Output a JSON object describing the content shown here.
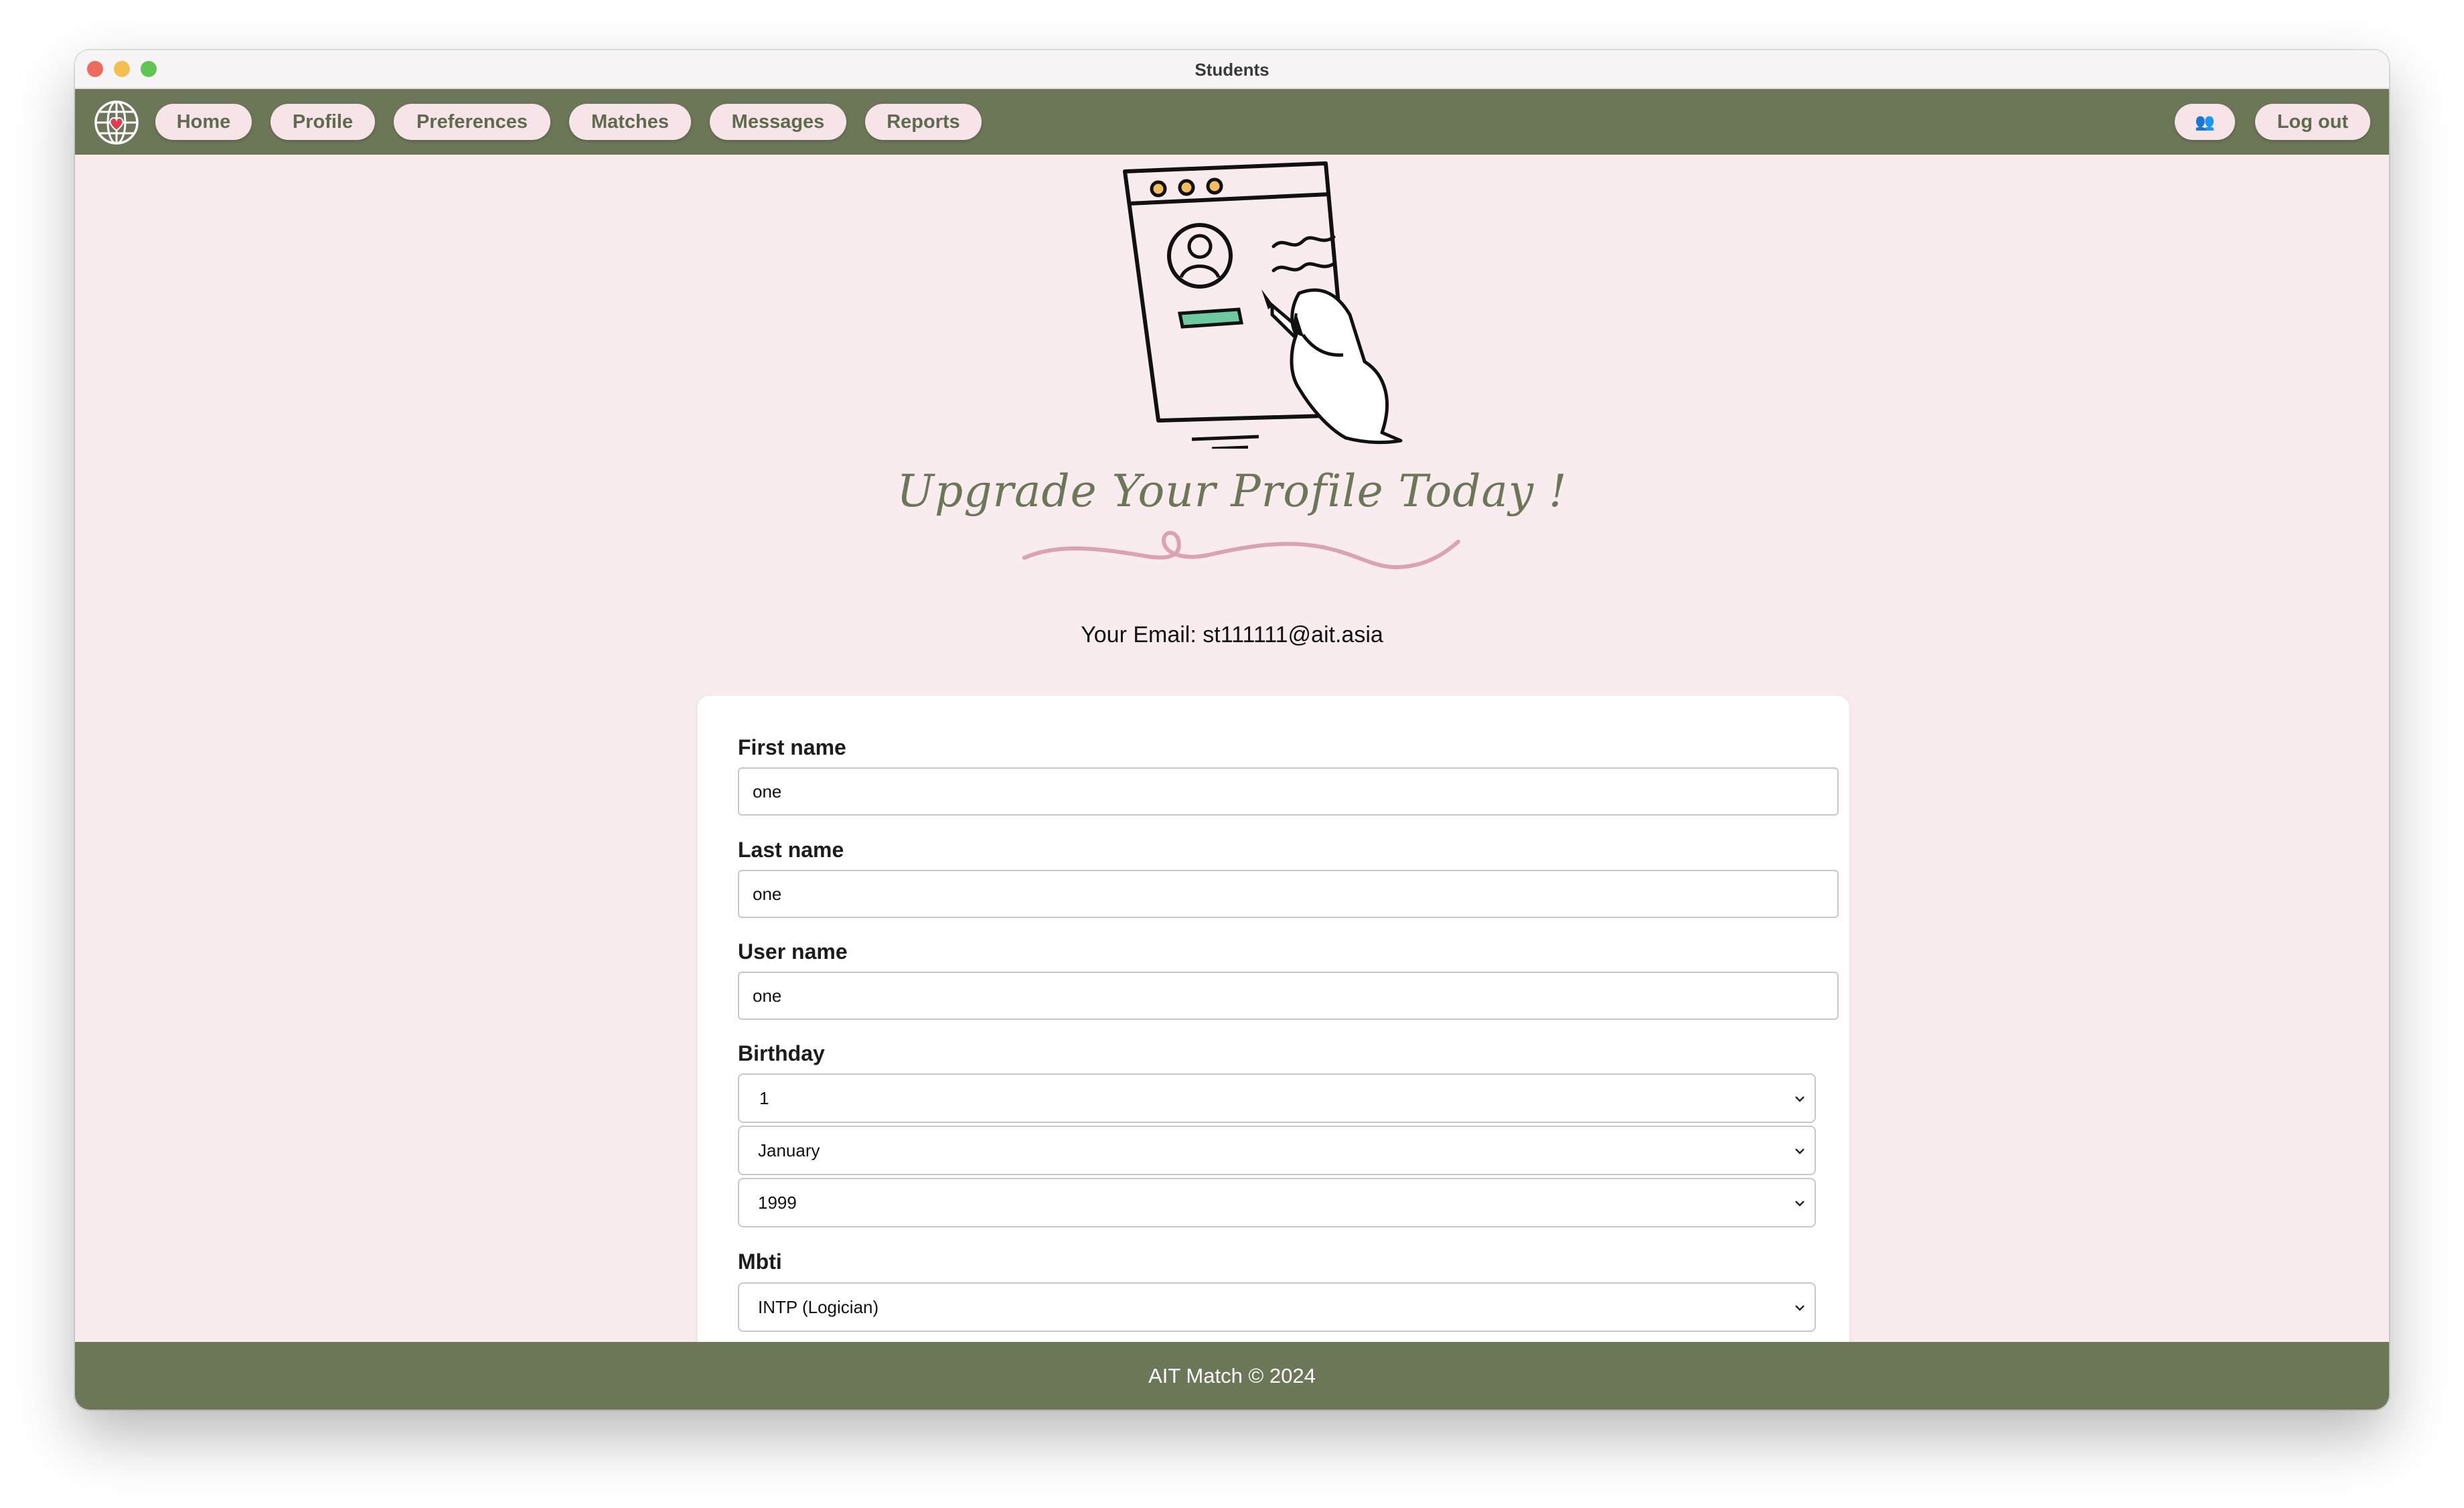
{
  "window": {
    "title": "Students"
  },
  "nav": {
    "logo_icon": "globe-heart-icon",
    "items": [
      {
        "label": "Home"
      },
      {
        "label": "Profile"
      },
      {
        "label": "Preferences"
      },
      {
        "label": "Matches"
      },
      {
        "label": "Messages"
      },
      {
        "label": "Reports"
      }
    ],
    "users_icon": "users-icon",
    "users_glyph": "👥",
    "logout_label": "Log out"
  },
  "hero": {
    "illustration": "profile-edit-illustration",
    "tagline": "Upgrade Your Profile Today !"
  },
  "account": {
    "email_line": "Your Email: st111111@ait.asia"
  },
  "form": {
    "first_name": {
      "label": "First name",
      "value": "one"
    },
    "last_name": {
      "label": "Last name",
      "value": "one"
    },
    "user_name": {
      "label": "User name",
      "value": "one"
    },
    "birthday": {
      "label": "Birthday",
      "day": "1",
      "month": "January",
      "year": "1999"
    },
    "mbti": {
      "label": "Mbti",
      "value": "INTP (Logician)"
    }
  },
  "footer": {
    "text": "AIT Match © 2024"
  },
  "colors": {
    "nav_bg": "#6b7757",
    "page_bg": "#f9ecee",
    "button_bg": "#f7e4e8",
    "button_text": "#5e6b4d",
    "accent_pink": "#d9a3b3"
  }
}
